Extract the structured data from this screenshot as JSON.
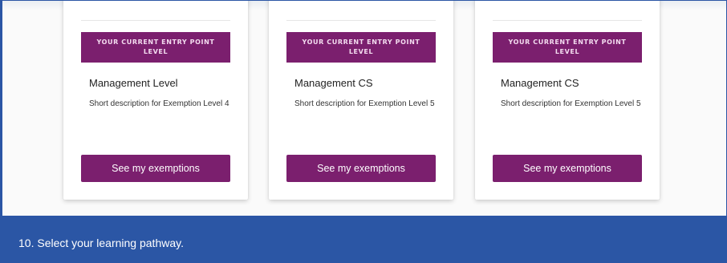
{
  "colors": {
    "accent_purple": "#7b1f6e",
    "caption_blue": "#2b56a5"
  },
  "cards": [
    {
      "badge": "YOUR CURRENT ENTRY POINT LEVEL",
      "title": "Management Level",
      "description": "Short description for Exemption Level 4",
      "button": "See my exemptions"
    },
    {
      "badge": "YOUR CURRENT ENTRY POINT LEVEL",
      "title": "Management CS",
      "description": "Short description for Exemption Level 5",
      "button": "See my exemptions"
    },
    {
      "badge": "YOUR CURRENT ENTRY POINT LEVEL",
      "title": "Management CS",
      "description": "Short description for Exemption Level 5",
      "button": "See my exemptions"
    }
  ],
  "caption": "10. Select your learning pathway."
}
